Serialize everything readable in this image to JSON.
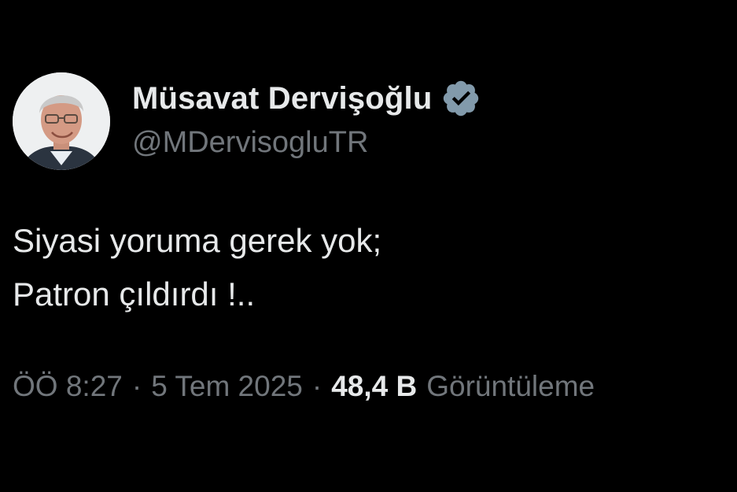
{
  "author": {
    "display_name": "Müsavat Dervişoğlu",
    "handle": "@MDervisogluTR",
    "verified_icon": "verified-badge-icon",
    "avatar": "profile-photo"
  },
  "tweet": {
    "lines": [
      "Siyasi yoruma gerek yok;",
      "Patron çıldırdı !.."
    ]
  },
  "meta": {
    "time": "ÖÖ 8:27",
    "separator": "·",
    "date": "5 Tem 2025",
    "views_count": "48,4 B",
    "views_label": "Görüntüleme"
  },
  "colors": {
    "background": "#000000",
    "primary_text": "#e7e9ea",
    "secondary_text": "#71767b",
    "verified_badge": "#829aab"
  }
}
